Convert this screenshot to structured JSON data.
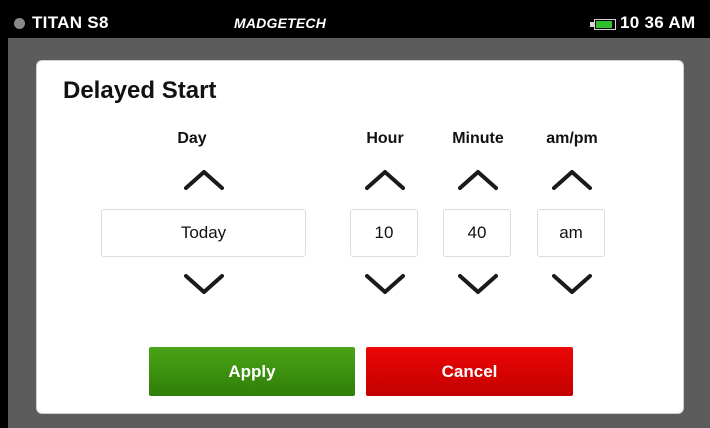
{
  "status_bar": {
    "device_name": "TITAN S8",
    "brand": "MADGETECH",
    "time": "10 36 AM",
    "battery_level": 0.9,
    "colors": {
      "battery": "#2fbf2f",
      "indicator_dot": "#8a8a8a"
    }
  },
  "dialog": {
    "title": "Delayed Start",
    "columns": {
      "day": {
        "label": "Day",
        "value": "Today"
      },
      "hour": {
        "label": "Hour",
        "value": "10"
      },
      "minute": {
        "label": "Minute",
        "value": "40"
      },
      "ampm": {
        "label": "am/pm",
        "value": "am"
      }
    },
    "icons": {
      "increment": "chevron-up-icon",
      "decrement": "chevron-down-icon"
    },
    "buttons": {
      "apply": {
        "label": "Apply",
        "color": "#3b8f0f"
      },
      "cancel": {
        "label": "Cancel",
        "color": "#d90000"
      }
    }
  }
}
